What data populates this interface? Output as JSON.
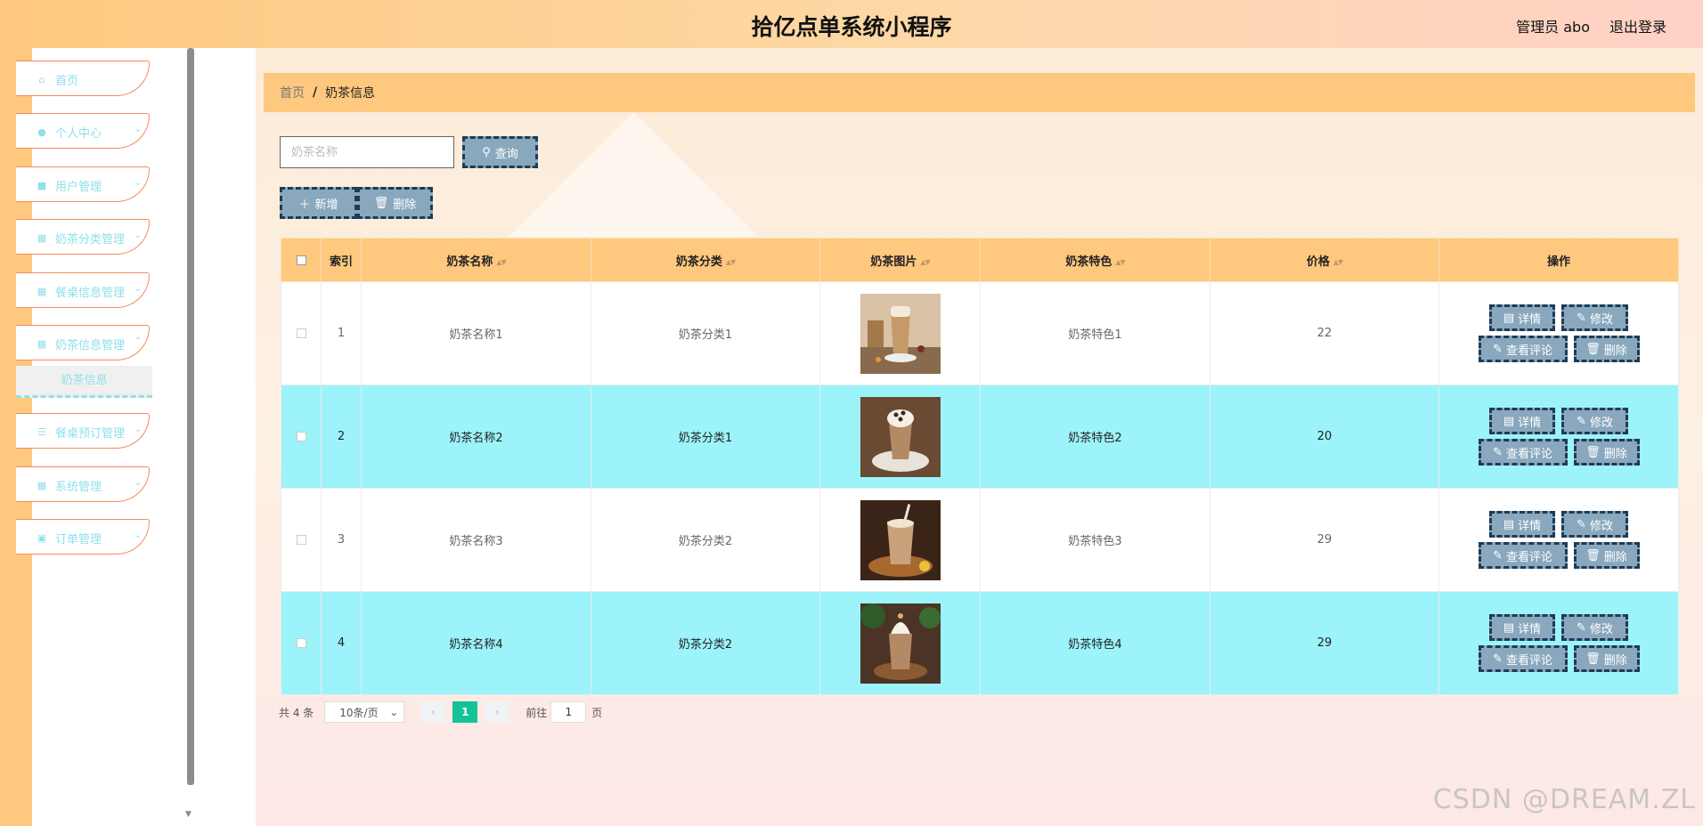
{
  "header": {
    "title": "拾亿点单系统小程序",
    "admin_label": "管理员 abo",
    "logout": "退出登录"
  },
  "sidebar": {
    "items": [
      {
        "label": "首页",
        "icon": "home-icon"
      },
      {
        "label": "个人中心",
        "icon": "user-icon"
      },
      {
        "label": "用户管理",
        "icon": "briefcase-icon"
      },
      {
        "label": "奶茶分类管理",
        "icon": "grid-icon"
      },
      {
        "label": "餐桌信息管理",
        "icon": "grid-icon"
      },
      {
        "label": "奶茶信息管理",
        "icon": "grid-icon"
      },
      {
        "label": "餐桌预订管理",
        "icon": "list-icon"
      },
      {
        "label": "系统管理",
        "icon": "grid-icon"
      },
      {
        "label": "订单管理",
        "icon": "clipboard-icon"
      }
    ],
    "submenu_active": "奶茶信息"
  },
  "breadcrumb": {
    "home": "首页",
    "separator": "/",
    "current": "奶茶信息"
  },
  "search": {
    "placeholder": "奶茶名称",
    "value": "",
    "button": "查询"
  },
  "toolbar": {
    "add": "新增",
    "delete": "删除"
  },
  "table": {
    "columns": [
      "索引",
      "奶茶名称",
      "奶茶分类",
      "奶茶图片",
      "奶茶特色",
      "价格",
      "操作"
    ],
    "rows": [
      {
        "index": "1",
        "name": "奶茶名称1",
        "category": "奶茶分类1",
        "feature": "奶茶特色1",
        "price": "22"
      },
      {
        "index": "2",
        "name": "奶茶名称2",
        "category": "奶茶分类1",
        "feature": "奶茶特色2",
        "price": "20"
      },
      {
        "index": "3",
        "name": "奶茶名称3",
        "category": "奶茶分类2",
        "feature": "奶茶特色3",
        "price": "29"
      },
      {
        "index": "4",
        "name": "奶茶名称4",
        "category": "奶茶分类2",
        "feature": "奶茶特色4",
        "price": "29"
      }
    ],
    "actions": {
      "detail": "详情",
      "edit": "修改",
      "review": "查看评论",
      "delete": "删除"
    }
  },
  "pagination": {
    "total": "共 4 条",
    "page_size": "10条/页",
    "current_page": "1",
    "goto_label": "前往",
    "goto_value": "1",
    "page_unit": "页"
  },
  "watermark": "CSDN @DREAM.ZL",
  "colors": {
    "header": "#fec87f",
    "accent_cyan": "#9cf3fa",
    "button": "#89a8bd",
    "page_active": "#13c397",
    "menu_border": "#f68a5c"
  }
}
